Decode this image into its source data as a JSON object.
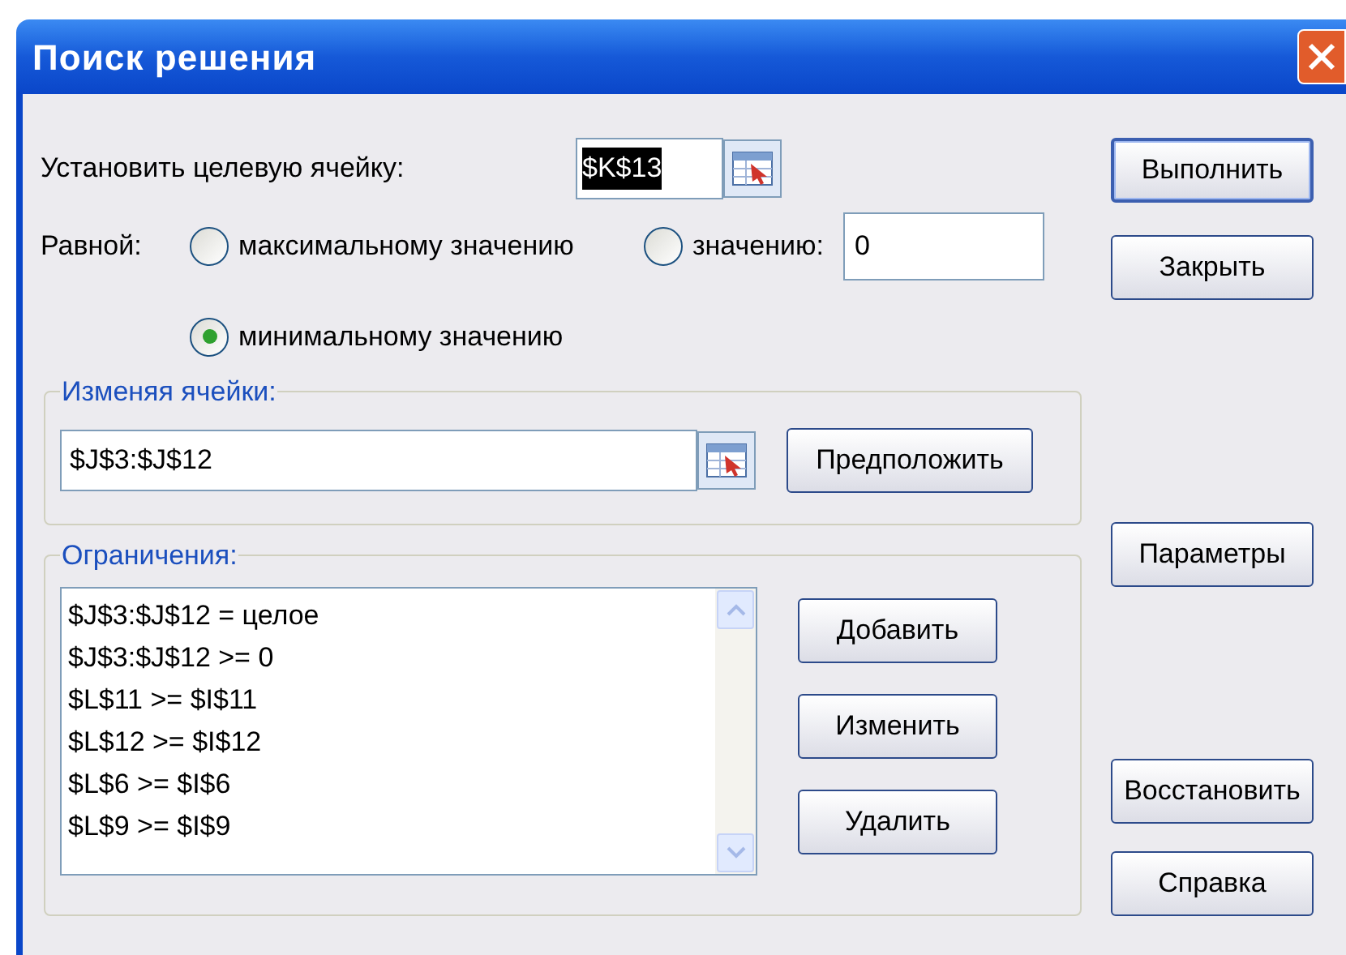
{
  "window": {
    "title": "Поиск решения"
  },
  "target": {
    "label": "Установить целевую ячейку:",
    "value": "$K$13",
    "selected": true
  },
  "equal_to": {
    "label": "Равной:",
    "options": [
      {
        "label": "максимальному значению",
        "selected": false
      },
      {
        "label": "значению:",
        "selected": false
      },
      {
        "label": "минимальному значению",
        "selected": true
      }
    ],
    "value_field": "0"
  },
  "changing_cells": {
    "title": "Изменяя ячейки:",
    "value": "$J$3:$J$12",
    "button": "Предположить"
  },
  "constraints": {
    "title": "Ограничения:",
    "items": [
      "$J$3:$J$12 = целое",
      "$J$3:$J$12 >= 0",
      "$L$11 >= $I$11",
      "$L$12 >= $I$12",
      "$L$6 >= $I$6",
      "$L$9 >= $I$9"
    ],
    "buttons": [
      "Добавить",
      "Изменить",
      "Удалить"
    ]
  },
  "buttons": [
    {
      "label": "Выполнить",
      "default": true
    },
    {
      "label": "Закрыть",
      "default": false
    },
    {
      "label": "Параметры",
      "default": false
    },
    {
      "label": "Восстановить",
      "default": false
    },
    {
      "label": "Справка",
      "default": false
    }
  ]
}
